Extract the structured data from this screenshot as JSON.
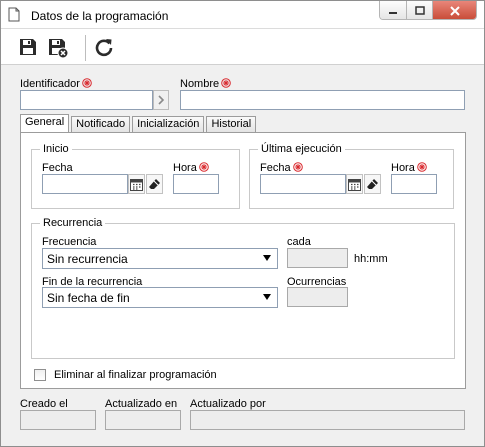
{
  "window": {
    "title": "Datos de la programación"
  },
  "header": {
    "identificador_label": "Identificador",
    "identificador_value": "",
    "nombre_label": "Nombre",
    "nombre_value": ""
  },
  "tabs": [
    {
      "label": "General",
      "active": true
    },
    {
      "label": "Notificado",
      "active": false
    },
    {
      "label": "Inicialización",
      "active": false
    },
    {
      "label": "Historial",
      "active": false
    }
  ],
  "inicio": {
    "group_title": "Inicio",
    "fecha_label": "Fecha",
    "fecha_value": "",
    "hora_label": "Hora",
    "hora_value": ""
  },
  "ultima": {
    "group_title": "Última ejecución",
    "fecha_label": "Fecha",
    "fecha_value": "",
    "hora_label": "Hora",
    "hora_value": ""
  },
  "recurrencia": {
    "group_title": "Recurrencia",
    "frecuencia_label": "Frecuencia",
    "frecuencia_value": "Sin recurrencia",
    "cada_label": "cada",
    "cada_value": "",
    "cada_unit": "hh:mm",
    "fin_label": "Fin de la recurrencia",
    "fin_value": "Sin fecha de fin",
    "ocurrencias_label": "Ocurrencias",
    "ocurrencias_value": ""
  },
  "eliminar": {
    "label": "Eliminar al finalizar programación",
    "checked": false
  },
  "footer": {
    "creado_label": "Creado el",
    "creado_value": "",
    "actualizado_en_label": "Actualizado en",
    "actualizado_en_value": "",
    "actualizado_por_label": "Actualizado por",
    "actualizado_por_value": ""
  },
  "colors": {
    "required": "#d9292e",
    "close_button": "#c74a35",
    "input_border": "#8f9fb3"
  }
}
